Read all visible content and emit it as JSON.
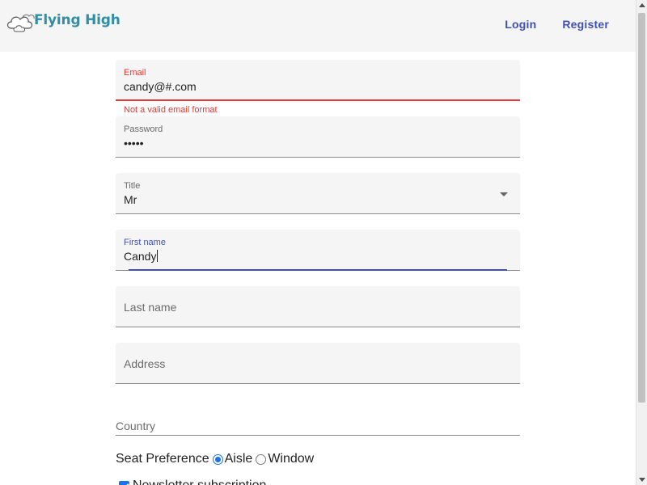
{
  "header": {
    "logo_text": "Flying High",
    "logo_icon": "cloud-icon",
    "nav": {
      "login": "Login",
      "register": "Register"
    }
  },
  "form": {
    "email": {
      "label": "Email",
      "value": "candy@#.com",
      "error": "Not a valid email format"
    },
    "password": {
      "label": "Password",
      "value": "•••••"
    },
    "title": {
      "label": "Title",
      "value": "Mr"
    },
    "first_name": {
      "label": "First name",
      "value": "Candy"
    },
    "last_name": {
      "placeholder": "Last name"
    },
    "address": {
      "placeholder": "Address"
    },
    "country": {
      "placeholder": "Country"
    },
    "seat_preference": {
      "label": "Seat Preference",
      "options": [
        "Aisle",
        "Window"
      ],
      "selected": "Aisle"
    },
    "newsletter": {
      "label": "Newsletter subscription",
      "checked": true
    }
  },
  "colors": {
    "accent": "#3f51b5",
    "error": "#e53935",
    "logo": "#2f8fa6",
    "control": "#1a73e8"
  }
}
